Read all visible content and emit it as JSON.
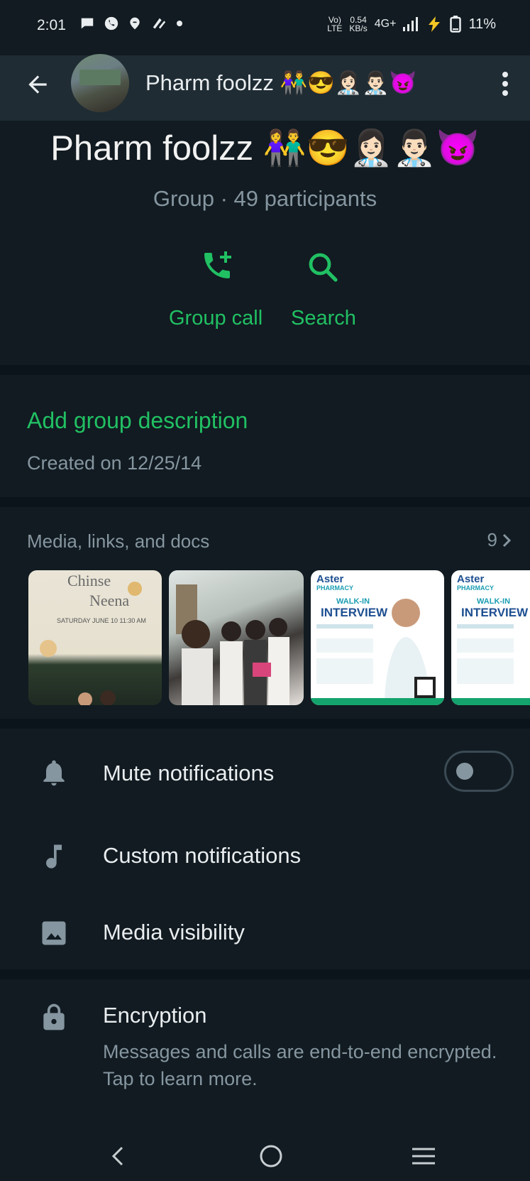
{
  "status_bar": {
    "time": "2:01",
    "network_top": "Vo)",
    "network_bottom": "LTE",
    "speed_top": "0.54",
    "speed_bottom": "KB/s",
    "signal": "4G+",
    "battery": "11%"
  },
  "header": {
    "group_name": "Pharm foolzz 👫😎👩🏻‍⚕️👨🏻‍⚕️😈"
  },
  "group": {
    "name": "Pharm foolzz 👫😎👩🏻‍⚕️👨🏻‍⚕️😈",
    "subtitle": "Group · 49 participants",
    "actions": [
      {
        "label": "Group call",
        "icon": "add-call-icon"
      },
      {
        "label": "Search",
        "icon": "search-icon"
      }
    ]
  },
  "description": {
    "add_label": "Add group description",
    "created": "Created on 12/25/14"
  },
  "media": {
    "header": "Media, links, and docs",
    "count": "9",
    "thumbnails": [
      {
        "kind": "invitation",
        "name1": "Chinse",
        "name2": "Neena",
        "line": "SATURDAY  JUNE 10  11:30 AM"
      },
      {
        "kind": "photo"
      },
      {
        "kind": "poster",
        "brand": "Aster",
        "sub": "PHARMACY",
        "walk": "WALK-IN",
        "title": "INTERVIEW"
      },
      {
        "kind": "poster",
        "brand": "Aster",
        "sub": "PHARMACY",
        "walk": "WALK-IN",
        "title": "INTERVIEW"
      }
    ]
  },
  "settings": {
    "mute": {
      "label": "Mute notifications",
      "icon": "bell-icon",
      "enabled": false
    },
    "custom": {
      "label": "Custom notifications",
      "icon": "music-note-icon"
    },
    "visibility": {
      "label": "Media visibility",
      "icon": "image-icon"
    },
    "encryption": {
      "label": "Encryption",
      "icon": "lock-icon",
      "subtitle": "Messages and calls are end-to-end encrypted. Tap to learn more."
    }
  },
  "colors": {
    "background": "#111b21",
    "header_bg": "#1f2c34",
    "accent": "#21c063",
    "secondary_text": "#8696a0"
  }
}
